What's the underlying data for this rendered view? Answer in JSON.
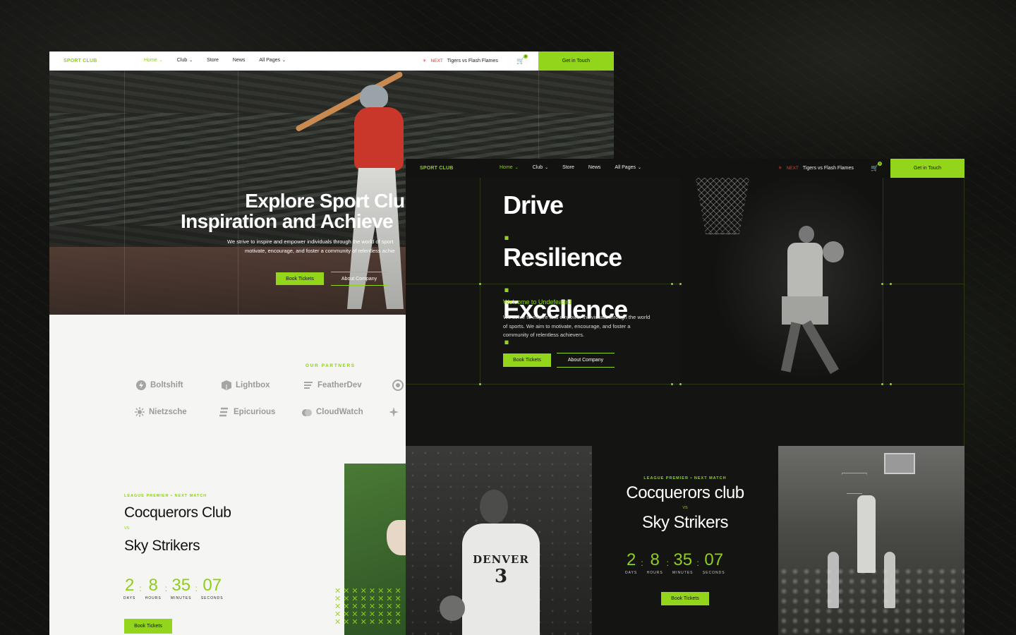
{
  "light_site": {
    "logo": "SPORT CLUB",
    "nav": [
      {
        "label": "Home",
        "dropdown": true,
        "active": true
      },
      {
        "label": "Club",
        "dropdown": true,
        "active": false
      },
      {
        "label": "Store",
        "dropdown": false,
        "active": false
      },
      {
        "label": "News",
        "dropdown": false,
        "active": false
      },
      {
        "label": "All Pages",
        "dropdown": true,
        "active": false
      }
    ],
    "next_label": "NEXT",
    "next_match": "Tigers vs Flash Flames",
    "cart_count": "0",
    "cta": "Get in Touch",
    "hero": {
      "title_line1": "Explore Sport Club",
      "title_line2": "Inspiration and Achieve",
      "desc_line1": "We strive to inspire and empower individuals through the world of sport",
      "desc_line2": "motivate, encourage, and foster a community of relentless achie",
      "btn_primary": "Book Tickets",
      "btn_secondary": "About Company"
    },
    "partners_label": "OUR PARTNERS",
    "partners": [
      "Boltshift",
      "Lightbox",
      "FeatherDev",
      "Nietzsche",
      "Epicurious",
      "CloudWatch"
    ],
    "match": {
      "tag": "LEAGUE PREMIER • NEXT MATCH",
      "team1": "Cocquerors Club",
      "vs": "VS",
      "team2": "Sky Strikers",
      "countdown": [
        {
          "value": "2",
          "label": "DAYS"
        },
        {
          "value": "8",
          "label": "HOURS"
        },
        {
          "value": "35",
          "label": "MINUTES"
        },
        {
          "value": "07",
          "label": "SECONDS"
        }
      ],
      "button": "Book Tickets"
    }
  },
  "dark_site": {
    "logo": "SPORT CLUB",
    "nav": [
      {
        "label": "Home",
        "dropdown": true,
        "active": true
      },
      {
        "label": "Club",
        "dropdown": true,
        "active": false
      },
      {
        "label": "Store",
        "dropdown": false,
        "active": false
      },
      {
        "label": "News",
        "dropdown": false,
        "active": false
      },
      {
        "label": "All Pages",
        "dropdown": true,
        "active": false
      }
    ],
    "next_label": "NEXT",
    "next_match": "Tigers vs Flash Flames",
    "cart_count": "0",
    "cta": "Get in Touch",
    "hero": {
      "word1": "Drive",
      "word2": "Resilience",
      "word3": "Excellence",
      "punct": ".",
      "welcome": "Welcome to Undefeated",
      "desc": "We strive to inspire and empower individuals through the world of sports. We aim to motivate, encourage, and foster a community of relentless achievers.",
      "btn_primary": "Book Tickets",
      "btn_secondary": "About Company"
    },
    "match": {
      "tag": "LEAGUE PREMIER • NEXT MATCH",
      "team1": "Cocquerors club",
      "vs": "VS",
      "team2": "Sky Strikers",
      "countdown": [
        {
          "value": "2",
          "label": "DAYS"
        },
        {
          "value": "8",
          "label": "HOURS"
        },
        {
          "value": "35",
          "label": "MINUTES"
        },
        {
          "value": "07",
          "label": "SECONDS"
        }
      ],
      "button": "Book Tickets"
    },
    "jersey_text": "DENVER",
    "jersey_number": "3"
  },
  "colors": {
    "accent": "#93d51a",
    "alert": "#e13a2c",
    "dark_bg": "#141513",
    "light_bg": "#f5f5f3"
  }
}
